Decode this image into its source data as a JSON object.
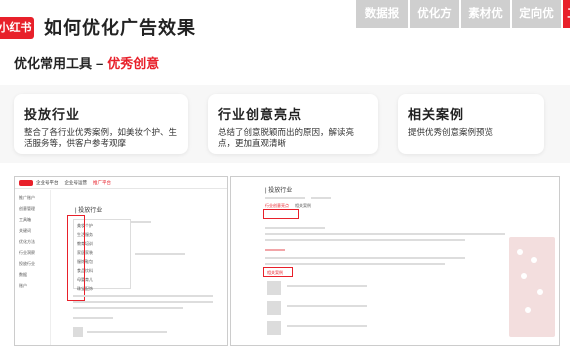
{
  "brand": {
    "logo_text": "小红书",
    "accent": "#e8202a",
    "tab_inactive": "#cfcfcf"
  },
  "header": {
    "title": "如何优化广告效果"
  },
  "nav": {
    "tabs": [
      {
        "label": "数据报表"
      },
      {
        "label": "优化方法"
      },
      {
        "label": "素材优化"
      },
      {
        "label": "定向优化"
      },
      {
        "label": "工"
      }
    ],
    "active_index": 4
  },
  "section": {
    "prefix": "优化常用工具",
    "separator": "–",
    "highlight": "优秀创意"
  },
  "cards": [
    {
      "title": "投放行业",
      "desc": "整合了各行业优秀案例，如美妆个护、生活服务等，供客户参考观摩"
    },
    {
      "title": "行业创意亮点",
      "desc": "总结了创意脱颖而出的原因，解读亮点，更加直观清晰"
    },
    {
      "title": "相关案例",
      "desc": "提供优秀创意案例预览"
    }
  ],
  "screenshot_left": {
    "brand": "小红书",
    "app_name": "企业号平台",
    "top_links": [
      "企业号运营",
      "推广平台"
    ],
    "sidebar": [
      "推广账户",
      "创意管理",
      "工具箱",
      "关键词",
      "优化方法",
      "行业洞察",
      "投放行业",
      "数据",
      "账户"
    ],
    "panel_title": "| 投放行业",
    "industry_options": [
      "美妆个护",
      "生活服务",
      "教育培训",
      "家居家装",
      "服饰鞋包",
      "食品饮料",
      "母婴育儿",
      "珠宝配饰"
    ]
  },
  "screenshot_right": {
    "panel_title": "| 投放行业",
    "tabs": [
      "行业创意亮点",
      "相关案例"
    ],
    "section_label": "相关案例"
  },
  "icons": [
    "logo-badge"
  ]
}
